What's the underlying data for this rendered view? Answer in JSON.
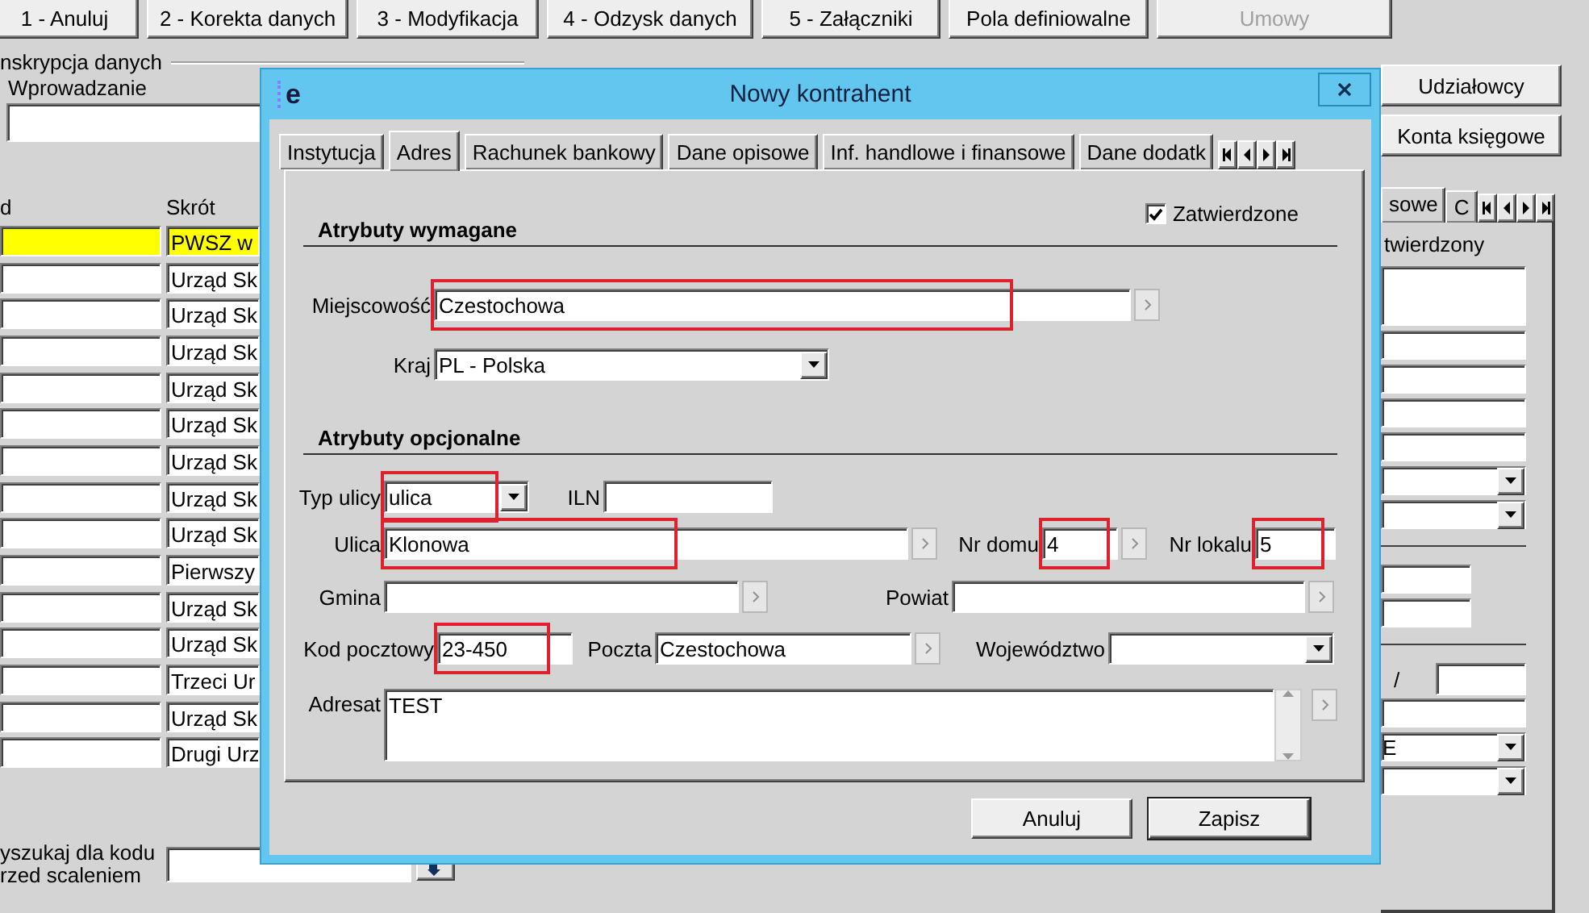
{
  "toolbar": [
    {
      "label": "1 - Anuluj",
      "disabled": false
    },
    {
      "label": "2 - Korekta danych",
      "disabled": false
    },
    {
      "label": "3 - Modyfikacja",
      "disabled": false
    },
    {
      "label": "4 - Odzysk danych",
      "disabled": false
    },
    {
      "label": "5 - Załączniki",
      "disabled": false
    },
    {
      "label": "Pola definiowalne",
      "disabled": false
    },
    {
      "label": "Umowy",
      "disabled": true
    }
  ],
  "left_panel": {
    "group_title": "nskrypcja danych",
    "mode_label": "Wprowadzanie",
    "grid": {
      "columns": [
        "d",
        "Skrót"
      ],
      "rows": [
        {
          "shortcut": "PWSZ w",
          "selected": true
        },
        {
          "shortcut": "Urząd Sk",
          "selected": false
        },
        {
          "shortcut": "Urząd Sk",
          "selected": false
        },
        {
          "shortcut": "Urząd Sk",
          "selected": false
        },
        {
          "shortcut": "Urząd Sk",
          "selected": false
        },
        {
          "shortcut": "Urząd Sk",
          "selected": false
        },
        {
          "shortcut": "Urząd Sk",
          "selected": false
        },
        {
          "shortcut": "Urząd Sk",
          "selected": false
        },
        {
          "shortcut": "Urząd Sk",
          "selected": false
        },
        {
          "shortcut": "Pierwszy",
          "selected": false
        },
        {
          "shortcut": "Urząd Sk",
          "selected": false
        },
        {
          "shortcut": "Urząd Sk",
          "selected": false
        },
        {
          "shortcut": "Trzeci Ur",
          "selected": false
        },
        {
          "shortcut": "Urząd Sk",
          "selected": false
        },
        {
          "shortcut": "Drugi Urz",
          "selected": false
        }
      ]
    },
    "search_label": [
      "yszukaj dla kodu",
      "rzed scaleniem"
    ]
  },
  "right_panel": {
    "buttons": [
      "Udziałowcy",
      "Konta księgowe"
    ],
    "tabs": [
      {
        "label": "sowe",
        "selected": true
      },
      {
        "label": "C",
        "selected": false
      }
    ],
    "status_label": "twierdzony",
    "date_separator": "/",
    "select_value": "E"
  },
  "dialog": {
    "logo_letter": "e",
    "title": "Nowy kontrahent",
    "tabs": [
      {
        "label": "Instytucja",
        "selected": false
      },
      {
        "label": "Adres",
        "selected": true
      },
      {
        "label": "Rachunek bankowy",
        "selected": false
      },
      {
        "label": "Dane opisowe",
        "selected": false
      },
      {
        "label": "Inf. handlowe i finansowe",
        "selected": false
      },
      {
        "label": "Dane dodatk",
        "selected": false
      }
    ],
    "checkbox": {
      "label": "Zatwierdzone",
      "checked": true
    },
    "sections": [
      {
        "title": "Atrybuty wymagane",
        "fields": [
          {
            "label": "Miejscowość",
            "kind": "lookup",
            "value": "Czestochowa",
            "highlighted": true
          },
          {
            "label": "Kraj",
            "kind": "select",
            "value": "PL - Polska",
            "highlighted": false
          }
        ]
      },
      {
        "title": "Atrybuty opcjonalne",
        "fields": [
          {
            "label": "Typ ulicy",
            "kind": "select",
            "value": "ulica",
            "highlighted": true
          },
          {
            "label": "ILN",
            "kind": "text",
            "highlighted": false
          },
          {
            "label": "Ulica",
            "kind": "lookup",
            "value": "Klonowa",
            "highlighted": true
          },
          {
            "label": "Nr domu",
            "kind": "lookup",
            "value": "4",
            "highlighted": true
          },
          {
            "label": "Nr lokalu",
            "kind": "text",
            "value": "5",
            "highlighted": true
          },
          {
            "label": "Gmina",
            "kind": "lookup",
            "highlighted": false
          },
          {
            "label": "Powiat",
            "kind": "lookup",
            "highlighted": false
          },
          {
            "label": "Kod pocztowy",
            "kind": "text",
            "value": "23-450",
            "highlighted": true
          },
          {
            "label": "Poczta",
            "kind": "lookup",
            "value": "Czestochowa",
            "highlighted": false
          },
          {
            "label": "Województwo",
            "kind": "select",
            "highlighted": false
          },
          {
            "label": "Adresat",
            "kind": "memo",
            "value": "TEST",
            "highlighted": false
          }
        ]
      }
    ],
    "buttons": [
      {
        "label": "Anuluj",
        "default": false
      },
      {
        "label": "Zapisz",
        "default": true
      }
    ]
  }
}
